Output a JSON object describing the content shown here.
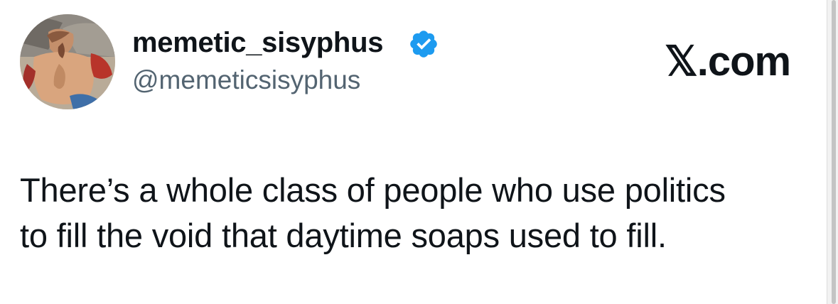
{
  "author": {
    "display_name": "memetic_sisyphus",
    "handle": "@memeticsisyphus",
    "verified": true,
    "avatar_icon": "classical-painting-avatar"
  },
  "brand": {
    "label": "𝕏.com"
  },
  "tweet": {
    "lines": [
      "There’s a whole class of people who use politics",
      "to fill the void that daytime soaps used to fill."
    ]
  },
  "colors": {
    "text": "#0f1419",
    "handle": "#536471",
    "verified_badge": "#1d9bf0"
  }
}
